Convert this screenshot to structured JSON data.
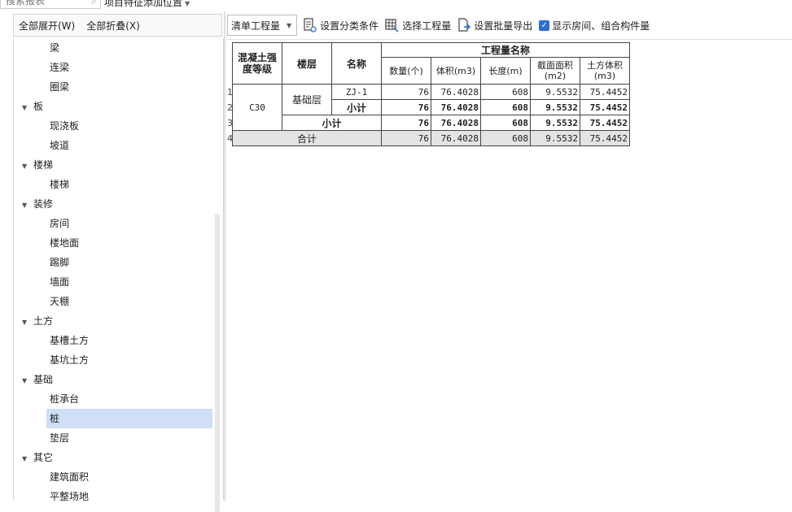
{
  "topbar": {
    "search_placeholder": "搜索报表",
    "position_label": "项目特征添加位置"
  },
  "left_toolbar": {
    "expand_all": "全部展开(W)",
    "collapse_all": "全部折叠(X)"
  },
  "tree": [
    {
      "label": "梁",
      "level": 1
    },
    {
      "label": "连梁",
      "level": 1
    },
    {
      "label": "圈梁",
      "level": 1
    },
    {
      "label": "板",
      "level": 0
    },
    {
      "label": "现浇板",
      "level": 1
    },
    {
      "label": "坡道",
      "level": 1
    },
    {
      "label": "楼梯",
      "level": 0
    },
    {
      "label": "楼梯",
      "level": 1
    },
    {
      "label": "装修",
      "level": 0
    },
    {
      "label": "房间",
      "level": 1
    },
    {
      "label": "楼地面",
      "level": 1
    },
    {
      "label": "踢脚",
      "level": 1
    },
    {
      "label": "墙面",
      "level": 1
    },
    {
      "label": "天棚",
      "level": 1
    },
    {
      "label": "土方",
      "level": 0
    },
    {
      "label": "基槽土方",
      "level": 1
    },
    {
      "label": "基坑土方",
      "level": 1
    },
    {
      "label": "基础",
      "level": 0
    },
    {
      "label": "桩承台",
      "level": 1
    },
    {
      "label": "桩",
      "level": 1,
      "selected": true
    },
    {
      "label": "垫层",
      "level": 1
    },
    {
      "label": "其它",
      "level": 0
    },
    {
      "label": "建筑面积",
      "level": 1
    },
    {
      "label": "平整场地",
      "level": 1
    }
  ],
  "right_toolbar": {
    "quantity_type": "清单工程量",
    "set_category": "设置分类条件",
    "select_quantity": "选择工程量",
    "batch_export": "设置批量导出",
    "show_rooms": "显示房间、组合构件量"
  },
  "report": {
    "headers": {
      "grade": "混凝土强度等级",
      "floor": "楼层",
      "name": "名称",
      "quantity_group": "工程量名称",
      "count": "数量(个)",
      "volume": "体积(m3)",
      "length": "长度(m)",
      "section_area": "截面面积(m2)",
      "earth_volume": "土方体积(m3)"
    },
    "row_numbers": [
      "1",
      "2",
      "3",
      "4"
    ],
    "grade": "C30",
    "floor": "基础层",
    "name": "ZJ-1",
    "row_data": {
      "count": "76",
      "volume": "76.4028",
      "length": "608",
      "section_area": "9.5532",
      "earth_volume": "75.4452"
    },
    "subtotal_label": "小计",
    "subtotal": {
      "count": "76",
      "volume": "76.4028",
      "length": "608",
      "section_area": "9.5532",
      "earth_volume": "75.4452"
    },
    "subtotal2_label": "小计",
    "subtotal2": {
      "count": "76",
      "volume": "76.4028",
      "length": "608",
      "section_area": "9.5532",
      "earth_volume": "75.4452"
    },
    "total_label": "合计",
    "total": {
      "count": "76",
      "volume": "76.4028",
      "length": "608",
      "section_area": "9.5532",
      "earth_volume": "75.4452"
    }
  }
}
